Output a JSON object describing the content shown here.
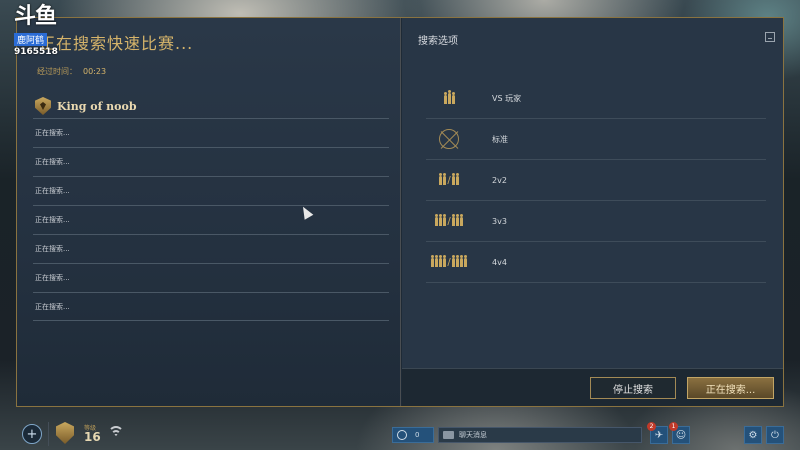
{
  "watermark": {
    "logo": "斗鱼",
    "badge": "鹿阿鹤",
    "room_id": "9165518"
  },
  "left_panel": {
    "title": "正在搜索快速比赛...",
    "elapsed_label": "经过时间：",
    "elapsed_value": "00:23",
    "team_name": "King of noob",
    "slots": [
      "正在搜索...",
      "正在搜索...",
      "正在搜索...",
      "正在搜索...",
      "正在搜索...",
      "正在搜索...",
      "正在搜索..."
    ]
  },
  "right_panel": {
    "title": "搜索选项",
    "modes": [
      {
        "label": "VS 玩家",
        "icon": "players-icon"
      },
      {
        "label": "标准",
        "icon": "crossed-swords-icon"
      },
      {
        "label": "2v2",
        "icon": "team-2v2-icon"
      },
      {
        "label": "3v3",
        "icon": "team-3v3-icon"
      },
      {
        "label": "4v4",
        "icon": "team-4v4-icon"
      }
    ],
    "stop_button": "停止搜索",
    "searching_button": "正在搜索..."
  },
  "taskbar": {
    "add_label": "+",
    "level_label": "等级",
    "level": "16",
    "friends_online": "0",
    "chat_placeholder": "聊天消息",
    "notif_1": "2",
    "notif_2": "1"
  },
  "colors": {
    "accent_gold": "#d6b46a",
    "panel_bg": "#283646",
    "frame_border": "#8a7340"
  }
}
